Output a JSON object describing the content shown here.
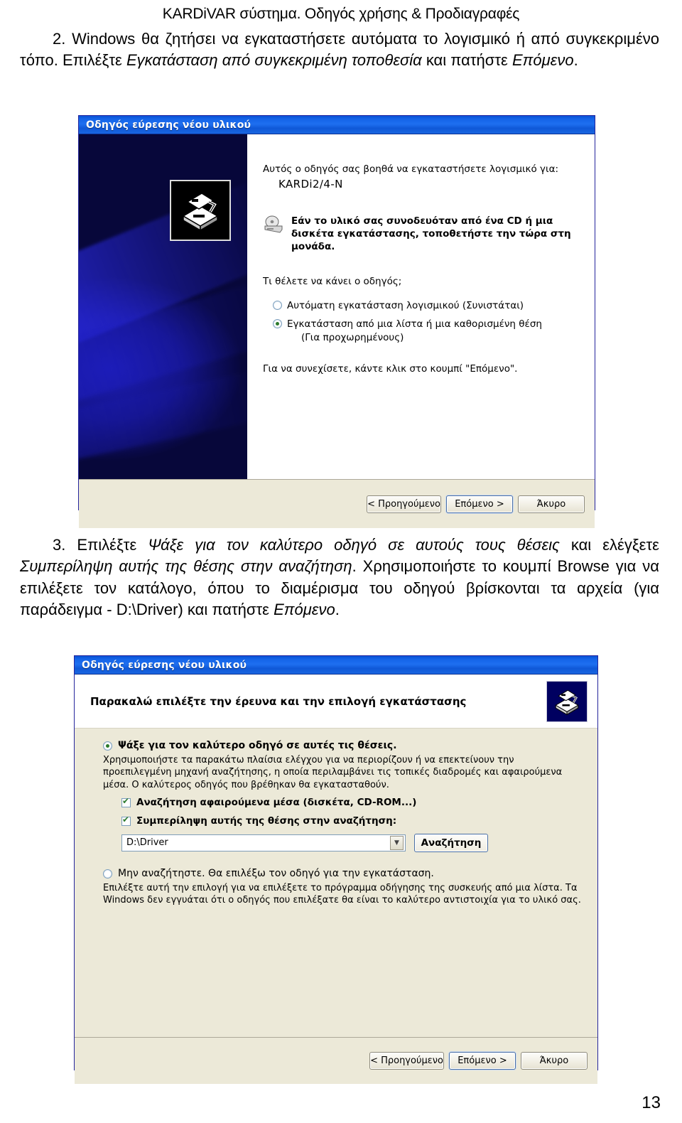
{
  "document": {
    "header": "KARDiVAR σύστημα. Οδηγός χρήσης & Προδιαγραφές",
    "page_number": "13",
    "step2": {
      "number": "2.",
      "t1": "Windows θα ζητήσει να εγκαταστήσετε αυτόματα το λογισμικό ή από συγκεκριμένο τόπο. Επιλέξτε ",
      "em1": "Εγκατάσταση από συγκεκριμένη τοποθεσία",
      "t2": " και πατήστε ",
      "em2": "Επόμενο",
      "t3": "."
    },
    "step3": {
      "number": "3.",
      "t1": "Επιλέξτε ",
      "em1": "Ψάξε για τον καλύτερο οδηγό σε αυτούς τους θέσεις",
      "t2": " και ελέγξετε ",
      "em2": "Συμπερίληψη αυτής της θέσης στην αναζήτηση",
      "t3": ". Χρησιμοποιήστε το κουμπί Browse για να επιλέξετε τον κατάλογο, όπου το διαμέρισμα του οδηγού βρίσκονται τα αρχεία (για παράδειγμα - D:\\Driver) και πατήστε ",
      "em3": "Επόμενο",
      "t4": "."
    }
  },
  "dialog1": {
    "title": "Οδηγός εύρεσης νέου υλικού",
    "banner_icon": "hardware-wizard-icon",
    "lead": "Αυτός ο οδηγός σας βοηθά να εγκαταστήσετε λογισμικό για:",
    "device_model": "KARDi2/4-N",
    "cd_icon": "cd-drive-icon",
    "cd_note": "Εάν το υλικό σας συνοδευόταν από ένα CD ή μια δισκέτα εγκατάστασης, τοποθετήστε την τώρα στη μονάδα.",
    "question": "Τι θέλετε να κάνει ο οδηγός;",
    "options": [
      {
        "label": "Αυτόματη εγκατάσταση λογισμικού (Συνιστάται)",
        "selected": false
      },
      {
        "label": "Εγκατάσταση από μια λίστα ή μια καθορισμένη θέση",
        "sub": "(Για προχωρημένους)",
        "selected": true
      }
    ],
    "tail": "Για να συνεχίσετε, κάντε κλικ στο κουμπί \"Επόμενο\".",
    "buttons": {
      "back": "< Προηγούμενο",
      "next": "Επόμενο >",
      "cancel": "Άκυρο"
    }
  },
  "dialog2": {
    "title": "Οδηγός εύρεσης νέου υλικού",
    "heading": "Παρακαλώ επιλέξτε την έρευνα και την επιλογή εγκατάστασης",
    "header_icon": "hardware-wizard-icon",
    "option1": {
      "label": "Ψάξε για τον καλύτερο οδηγό σε αυτές τις θέσεις.",
      "selected": true,
      "description": "Χρησιμοποιήστε τα παρακάτω πλαίσια ελέγχου για να περιορίζουν ή να επεκτείνουν την προεπιλεγμένη μηχανή αναζήτησης, η οποία περιλαμβάνει τις τοπικές διαδρομές και αφαιρούμενα μέσα. Ο καλύτερος οδηγός που βρέθηκαν θα εγκατασταθούν.",
      "checkboxes": [
        {
          "label": "Αναζήτηση αφαιρούμενα μέσα (δισκέτα, CD-ROM...)",
          "checked": true
        },
        {
          "label": "Συμπερίληψη αυτής της θέσης στην αναζήτηση:",
          "checked": true
        }
      ],
      "path_value": "D:\\Driver",
      "browse_label": "Αναζήτηση"
    },
    "option2": {
      "label": "Μην αναζήτηστε. Θα επιλέξω τον οδηγό για την εγκατάσταση.",
      "selected": false,
      "description": "Επιλέξτε αυτή την επιλογή για να επιλέξετε το πρόγραμμα οδήγησης της συσκευής από μια λίστα. Τα Windows δεν εγγυάται ότι ο οδηγός που επιλέξατε θα είναι το καλύτερο αντιστοιχία για το υλικό σας."
    },
    "buttons": {
      "back": "< Προηγούμενο",
      "next": "Επόμενο >",
      "cancel": "Άκυρο"
    }
  },
  "colors": {
    "titlebar_blue": "#1464e8",
    "dialog_face": "#ece9d8",
    "banner_navy": "#07073a",
    "check_green": "#2c7a2c"
  }
}
